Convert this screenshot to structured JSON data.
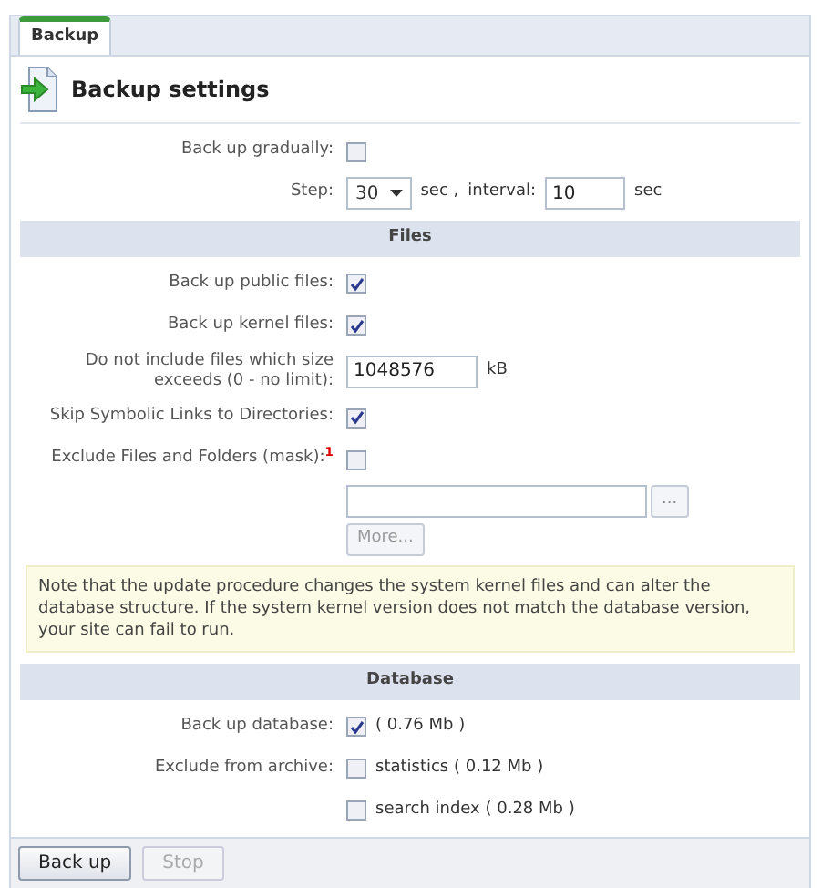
{
  "tab": {
    "label": "Backup",
    "selected": true
  },
  "heading": "Backup settings",
  "general": [
    {
      "kind": "checkbox",
      "label": "Back up gradually:",
      "checked": false
    },
    {
      "kind": "step",
      "label": "Step:",
      "select_value": "30",
      "unit": "sec ,",
      "interval_label": "interval:",
      "interval_value": "10",
      "interval_unit": "sec"
    }
  ],
  "files": {
    "title": "Files",
    "rows": [
      {
        "kind": "checkbox",
        "label": "Back up public files:",
        "checked": true
      },
      {
        "kind": "checkbox",
        "label": "Back up kernel files:",
        "checked": true
      },
      {
        "kind": "number",
        "label": "Do not include files which size exceeds (0 - no limit):",
        "value": "1048576",
        "unit": "kB"
      },
      {
        "kind": "checkbox",
        "label": "Skip Symbolic Links to Directories:",
        "checked": true
      },
      {
        "kind": "checkbox",
        "label": "Exclude Files and Folders (mask):$^{1}$",
        "checked": false
      },
      {
        "kind": "mask",
        "browse": "...",
        "more": "More...",
        "more_disabled": true
      }
    ]
  },
  "note": "Note that the update procedure changes the system kernel files and can alter the database structure. If the system kernel version does not match the database version, your site can fail to run.",
  "database": {
    "title": "Database",
    "rows": [
      {
        "kind": "checkbox",
        "label": "Back up database:",
        "checked": true,
        "text": "( 0.76 Mb )"
      },
      {
        "kind": "checkbox",
        "label": "Exclude from archive:",
        "checked": false,
        "text": "statistics ( 0.12 Mb )"
      },
      {
        "kind": "checkbox",
        "checked": false,
        "text": "search index ( 0.28 Mb )"
      }
    ]
  },
  "buttons": [
    {
      "label": "Back up",
      "disabled": false
    },
    {
      "label": "Stop",
      "disabled": true
    }
  ]
}
